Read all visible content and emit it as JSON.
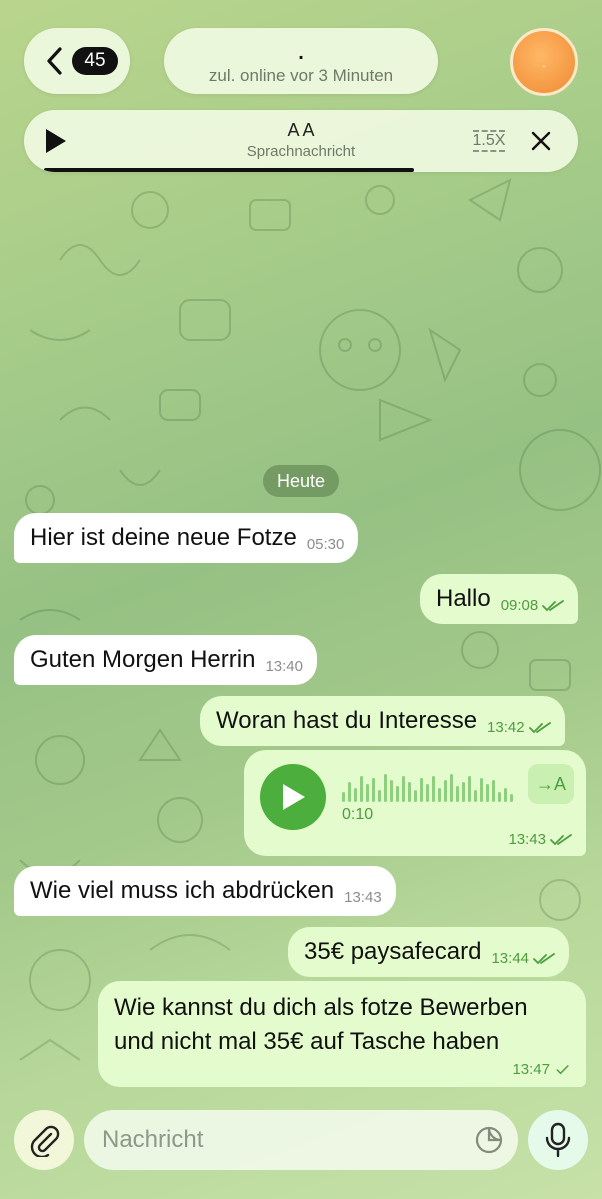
{
  "header": {
    "back_count": "45",
    "chat_name": ".",
    "status": "zul. online vor 3 Minuten",
    "avatar_initial": "."
  },
  "player": {
    "title": "A A",
    "subtitle": "Sprachnachricht",
    "speed": "1.5X",
    "progress": 0.72
  },
  "date_chip": "Heute",
  "messages": [
    {
      "direction": "in",
      "text": "Hier ist deine neue Fotze",
      "time": "05:30"
    },
    {
      "direction": "out",
      "text": "Hallo",
      "time": "09:08",
      "status": "read"
    },
    {
      "direction": "in",
      "text": "Guten Morgen Herrin",
      "time": "13:40"
    },
    {
      "direction": "out",
      "text": "Woran hast du Interesse",
      "time": "13:42",
      "status": "read"
    },
    {
      "direction": "out",
      "type": "voice",
      "duration": "0:10",
      "transcribe_label": "→A",
      "time": "13:43",
      "status": "read"
    },
    {
      "direction": "in",
      "text": "Wie viel muss ich abdrücken",
      "time": "13:43"
    },
    {
      "direction": "out",
      "text": "35€ paysafecard",
      "time": "13:44",
      "status": "read"
    },
    {
      "direction": "out",
      "text_line1": "Wie kannst du dich als fotze Bewerben",
      "text_line2": "und nicht mal 35€ auf Tasche haben",
      "time": "13:47",
      "status": "sent"
    }
  ],
  "composer": {
    "placeholder": "Nachricht"
  },
  "colors": {
    "outgoing_bubble": "#e3fbcd",
    "incoming_bubble": "#ffffff",
    "accent_green": "#4cae3c",
    "meta_green": "#4c9e3e"
  },
  "icons": [
    "back-chevron-icon",
    "play-icon",
    "playback-speed-icon",
    "close-icon",
    "double-check-icon",
    "single-check-icon",
    "translate-icon",
    "paperclip-icon",
    "sticker-icon",
    "microphone-icon"
  ]
}
